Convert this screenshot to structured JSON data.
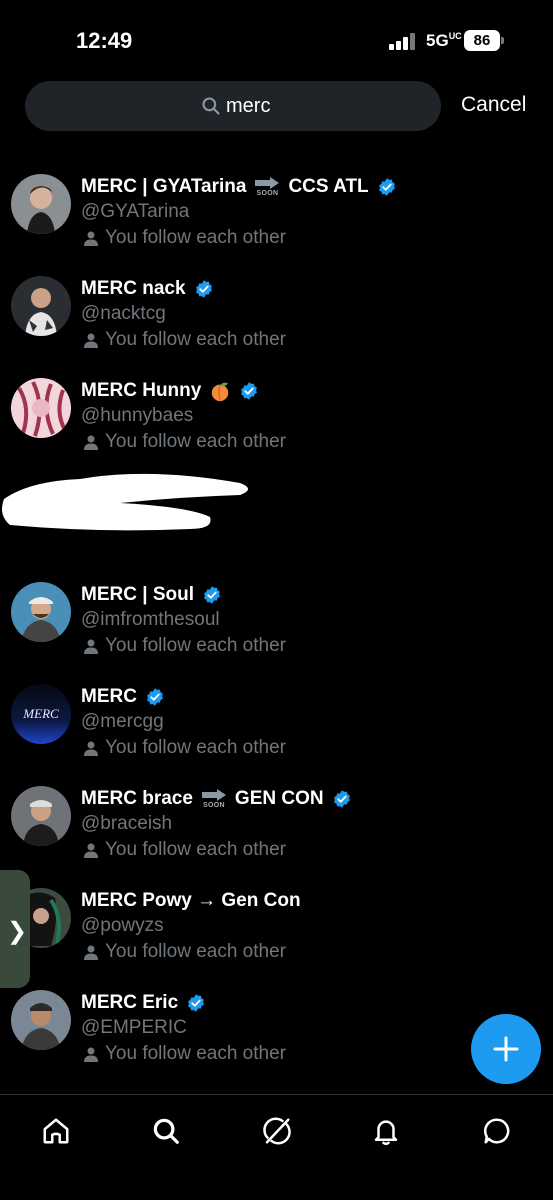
{
  "status_bar": {
    "time": "12:49",
    "network": "5G",
    "battery": "86"
  },
  "search": {
    "query": "merc",
    "cancel_label": "Cancel"
  },
  "results": [
    {
      "name": "MERC | GYATarina",
      "soon_suffix": "CCS ATL",
      "soon_label": "SOON",
      "handle": "@GYATarina",
      "verified": true,
      "status": "You follow each other"
    },
    {
      "name": "MERC nack",
      "handle": "@nacktcg",
      "verified": true,
      "status": "You follow each other"
    },
    {
      "name": "MERC Hunny",
      "emoji": "peach",
      "handle": "@hunnybaes",
      "verified": true,
      "status": "You follow each other"
    },
    {
      "name": "MERC | Soul",
      "handle": "@imfromthesoul",
      "verified": true,
      "status": "You follow each other"
    },
    {
      "name": "MERC",
      "handle": "@mercgg",
      "verified": true,
      "status": "You follow each other",
      "avatar_text": "MERC"
    },
    {
      "name": "MERC brace",
      "soon_suffix": "GEN CON",
      "soon_label": "SOON",
      "handle": "@braceish",
      "verified": true,
      "status": "You follow each other"
    },
    {
      "name": "MERC Powy → Gen Con",
      "handle": "@powyzs",
      "verified": false,
      "status": "You follow each other"
    },
    {
      "name": "MERC Eric",
      "handle": "@EMPERIC",
      "verified": true,
      "status": "You follow each other"
    }
  ],
  "colors": {
    "accent": "#1d9bf0",
    "background": "#000000",
    "secondary_text": "#71767b"
  },
  "nav": [
    "home-icon",
    "search-icon",
    "grok-icon",
    "notifications-icon",
    "messages-icon"
  ]
}
